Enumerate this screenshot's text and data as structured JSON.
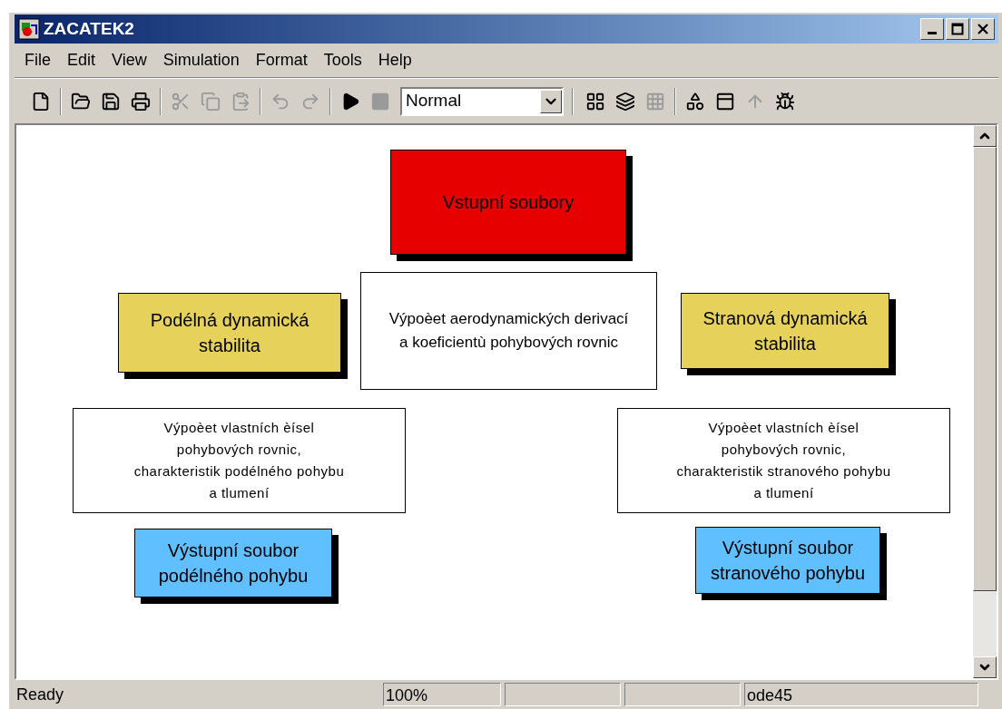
{
  "window": {
    "title": "ZACATEK2"
  },
  "menu": [
    "File",
    "Edit",
    "View",
    "Simulation",
    "Format",
    "Tools",
    "Help"
  ],
  "toolbar": [
    {
      "kind": "new",
      "disabled": false
    },
    {
      "kind": "open",
      "disabled": false
    },
    {
      "kind": "save",
      "disabled": false
    },
    {
      "kind": "print",
      "disabled": false
    },
    {
      "kind": "cut",
      "disabled": true
    },
    {
      "kind": "copy",
      "disabled": true
    },
    {
      "kind": "paste",
      "disabled": true
    },
    {
      "kind": "undo",
      "disabled": true
    },
    {
      "kind": "redo",
      "disabled": true
    },
    {
      "kind": "start",
      "disabled": false
    },
    {
      "kind": "stop",
      "disabled": true
    }
  ],
  "mode_select": {
    "value": "Normal"
  },
  "toolbar_right": [
    {
      "kind": "library",
      "disabled": false
    },
    {
      "kind": "update",
      "disabled": false
    },
    {
      "kind": "grid",
      "disabled": true
    },
    {
      "kind": "browser",
      "disabled": false
    },
    {
      "kind": "window",
      "disabled": false
    },
    {
      "kind": "up",
      "disabled": true
    },
    {
      "kind": "debug",
      "disabled": false
    }
  ],
  "blocks": [
    {
      "kind": "block",
      "color": "#e60000",
      "lines": [
        "Vstupní soubory"
      ]
    },
    {
      "kind": "block",
      "color": "#e6d25a",
      "lines": [
        "Podélná dynamická",
        "stabilita"
      ]
    },
    {
      "kind": "label",
      "color": "#ffffff",
      "lines": [
        "Výpoèet aerodynamických derivací",
        "a koeficientù pohybových rovnic"
      ]
    },
    {
      "kind": "block",
      "color": "#e6d25a",
      "lines": [
        "Stranová dynamická",
        "stabilita"
      ]
    },
    {
      "kind": "note",
      "color": "#ffffff",
      "lines": [
        "Výpoèet vlastních èísel",
        "pohybových rovnic,",
        "charakteristik podélného pohybu",
        "a tlumení"
      ]
    },
    {
      "kind": "note",
      "color": "#ffffff",
      "lines": [
        "Výpoèet vlastních èísel",
        "pohybových rovnic,",
        "charakteristik stranového pohybu",
        "a tlumení"
      ]
    },
    {
      "kind": "block",
      "color": "#5fbfff",
      "lines": [
        "Výstupní soubor",
        "podélného pohybu"
      ]
    },
    {
      "kind": "block",
      "color": "#5fbfff",
      "lines": [
        "Výstupní soubor",
        "stranového pohybu"
      ]
    }
  ],
  "status_bar": {
    "message": "Ready",
    "zoom": "100%",
    "solver": "ode45"
  }
}
